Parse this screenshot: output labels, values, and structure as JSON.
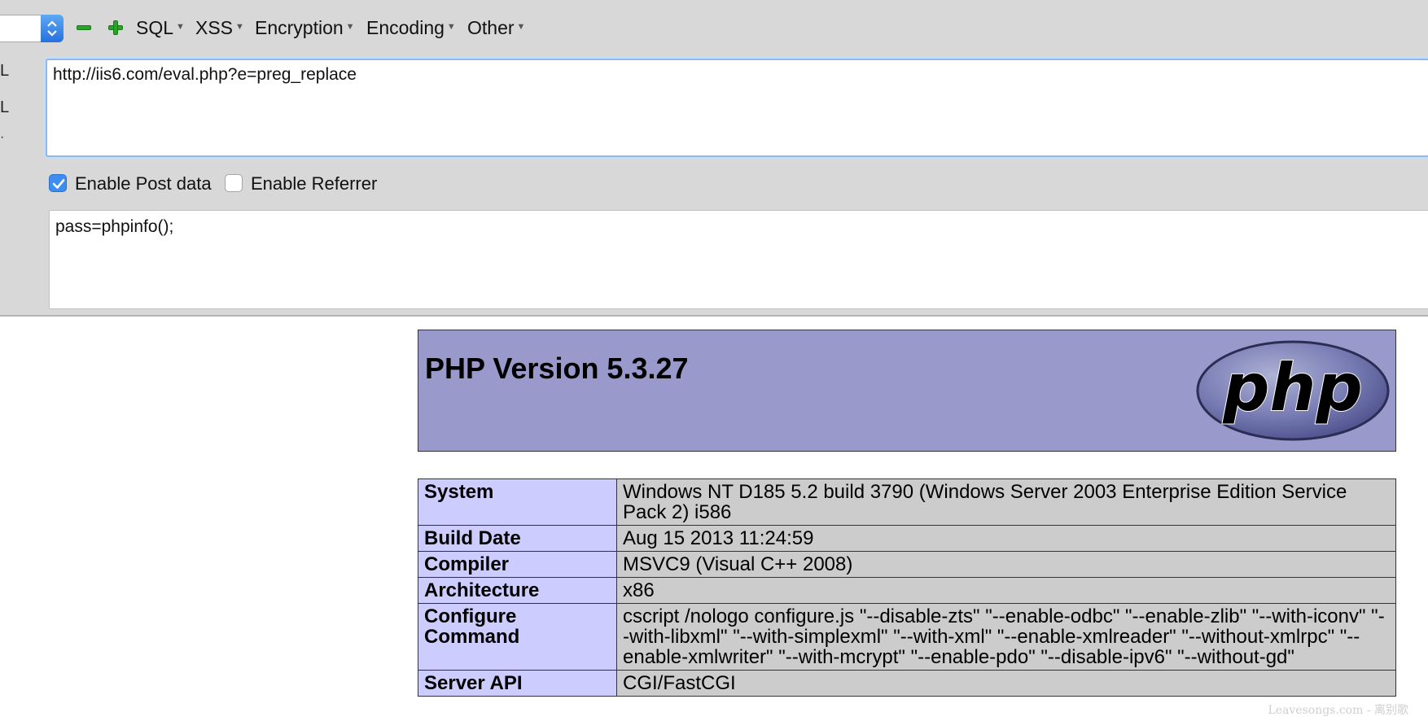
{
  "hackbar": {
    "menus": [
      "SQL",
      "XSS",
      "Encryption",
      "Encoding",
      "Other"
    ],
    "side_labels": [
      "L",
      "L"
    ],
    "url": "http://iis6.com/eval.php?e=preg_replace",
    "enable_post_label": "Enable Post data",
    "enable_post_checked": true,
    "enable_referrer_label": "Enable Referrer",
    "enable_referrer_checked": false,
    "post_data": "pass=phpinfo();"
  },
  "phpinfo": {
    "title": "PHP Version 5.3.27",
    "logo_text": "php",
    "rows": [
      {
        "key": "System",
        "value": "Windows NT D185 5.2 build 3790 (Windows Server 2003 Enterprise Edition Service Pack 2) i586"
      },
      {
        "key": "Build Date",
        "value": "Aug 15 2013 11:24:59"
      },
      {
        "key": "Compiler",
        "value": "MSVC9 (Visual C++ 2008)"
      },
      {
        "key": "Architecture",
        "value": "x86"
      },
      {
        "key": "Configure Command",
        "value": "cscript /nologo configure.js \"--disable-zts\" \"--enable-odbc\" \"--enable-zlib\" \"--with-iconv\" \"--with-libxml\" \"--with-simplexml\" \"--with-xml\" \"--enable-xmlreader\" \"--without-xmlrpc\" \"--enable-xmlwriter\" \"--with-mcrypt\" \"--enable-pdo\" \"--disable-ipv6\" \"--without-gd\""
      },
      {
        "key": "Server API",
        "value": "CGI/FastCGI"
      }
    ]
  },
  "watermark": "Leavesongs.com - 离别歌",
  "colors": {
    "panel_bg": "#d8d8d8",
    "php_header": "#9999cc",
    "key_cell": "#ccccff",
    "value_cell": "#cccccc",
    "accent_blue": "#3d8ef0",
    "icon_green": "#2aa32a"
  }
}
